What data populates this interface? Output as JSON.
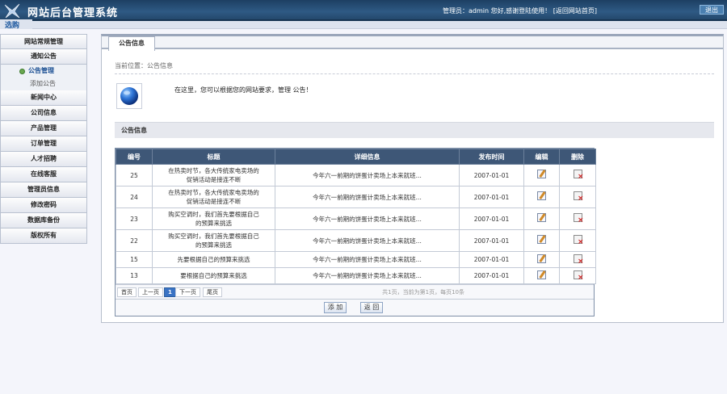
{
  "header": {
    "logo_text": "选购",
    "title": "网站后台管理系统",
    "user_prefix": "管理员：",
    "username": "admin",
    "greeting": " 您好,感谢登陆使用！",
    "home_link": "[返回网站首页]",
    "logout_label": "退出"
  },
  "sidebar": {
    "items": [
      {
        "label": "网站常规管理"
      },
      {
        "label": "通知公告"
      },
      {
        "label": "公告管理"
      },
      {
        "label": "添加公告"
      },
      {
        "label": "新闻中心"
      },
      {
        "label": "公司信息"
      },
      {
        "label": "产品管理"
      },
      {
        "label": "订单管理"
      },
      {
        "label": "人才招聘"
      },
      {
        "label": "在线客服"
      },
      {
        "label": "管理员信息"
      },
      {
        "label": "修改密码"
      },
      {
        "label": "数据库备份"
      },
      {
        "label": "版权所有"
      }
    ]
  },
  "content": {
    "tab_label": "公告信息",
    "breadcrumb": "当前位置：公告信息",
    "intro": "在这里，您可以根据您的网站要求，管理 公告！",
    "section_title": "公告信息",
    "table": {
      "headers": [
        "编号",
        "标题",
        "详细信息",
        "发布时间",
        "编辑",
        "删除"
      ],
      "rows": [
        {
          "id": "25",
          "title": "在热卖时节，各大传统家电卖场的促销活动是接连不断",
          "detail": "今年六一前期的饼蛋计卖场上本来就班...",
          "date": "2007-01-01"
        },
        {
          "id": "24",
          "title": "在热卖时节，各大传统家电卖场的促销活动是接连不断",
          "detail": "今年六一前期的饼蛋计卖场上本来就班...",
          "date": "2007-01-01"
        },
        {
          "id": "23",
          "title": "购买空调时，我们首先要根据自己的预算来挑选",
          "detail": "今年六一前期的饼蛋计卖场上本来就班...",
          "date": "2007-01-01"
        },
        {
          "id": "22",
          "title": "购买空调时，我们首先要根据自己的预算来挑选",
          "detail": "今年六一前期的饼蛋计卖场上本来就班...",
          "date": "2007-01-01"
        },
        {
          "id": "15",
          "title": "先要根据自己的预算来挑选",
          "detail": "今年六一前期的饼蛋计卖场上本来就班...",
          "date": "2007-01-01"
        },
        {
          "id": "13",
          "title": "要根据自己的预算来挑选",
          "detail": "今年六一前期的饼蛋计卖场上本来就班...",
          "date": "2007-01-01"
        }
      ]
    },
    "pager": {
      "first": "首页",
      "prev": "上一页",
      "current": "1",
      "next": "下一页",
      "last": "尾页",
      "info": "共1页，当前为第1页，每页10条"
    },
    "actions": {
      "add": "添 加",
      "back": "返 回"
    }
  },
  "colors": {
    "header": "#2e5a84",
    "table_header": "#3e5777",
    "accent": "#3a73c4"
  },
  "icons": [
    "logo-icon",
    "globe-icon",
    "active-dot-icon",
    "edit-icon",
    "delete-icon"
  ]
}
